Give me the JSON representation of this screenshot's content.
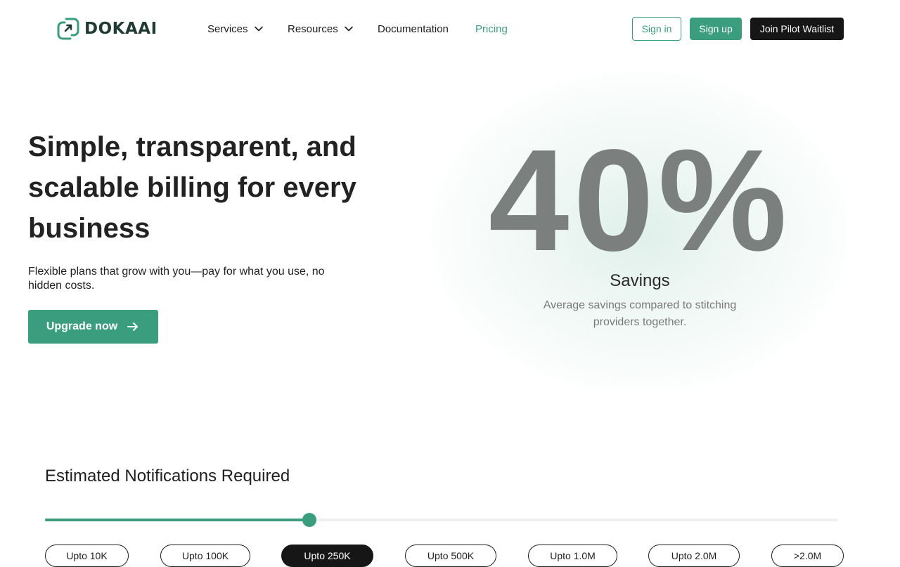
{
  "brand": {
    "name": "DOKAAI",
    "accent_color": "#3a9e7e",
    "dark_color": "#161616"
  },
  "nav": {
    "items": [
      {
        "label": "Services",
        "icon": "chevron-down-icon"
      },
      {
        "label": "Resources",
        "icon": "chevron-down-icon"
      },
      {
        "label": "Documentation"
      },
      {
        "label": "Pricing",
        "active": true
      }
    ],
    "sign_in": "Sign in",
    "sign_up": "Sign up",
    "waitlist": "Join Pilot Waitlist"
  },
  "hero": {
    "title": "Simple, transparent, and scalable billing for every business",
    "subtitle": "Flexible plans that grow with you—pay for what you use, no hidden costs.",
    "cta": "Upgrade now",
    "cta_icon": "arrow-right-icon"
  },
  "stat": {
    "value": "40%",
    "label": "Savings",
    "description": "Average savings compared to stitching providers together."
  },
  "estimator": {
    "title": "Estimated Notifications Required",
    "slider_value_fraction": 0.333,
    "selected_index": 2,
    "tiers": [
      "Upto 10K",
      "Upto 100K",
      "Upto 250K",
      "Upto 500K",
      "Upto 1.0M",
      "Upto 2.0M",
      ">2.0M"
    ]
  }
}
